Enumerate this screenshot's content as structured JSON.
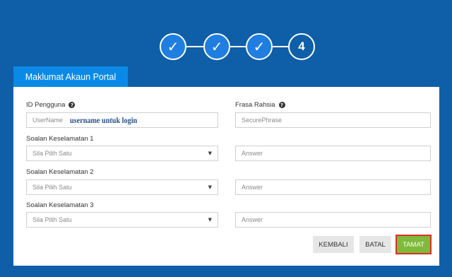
{
  "stepper": {
    "steps": [
      {
        "state": "done",
        "icon": "check-icon",
        "glyph": "✓"
      },
      {
        "state": "done",
        "icon": "check-icon",
        "glyph": "✓"
      },
      {
        "state": "done",
        "icon": "check-icon",
        "glyph": "✓"
      },
      {
        "state": "current",
        "label": "4"
      }
    ]
  },
  "tab": {
    "label": "Maklumat Akaun Portal"
  },
  "form": {
    "user_id": {
      "label": "ID Pengguna",
      "placeholder": "UserName",
      "note": "username untuk login"
    },
    "secret_phrase": {
      "label": "Frasa Rahsia",
      "placeholder": "SecurePhrase"
    },
    "questions": [
      {
        "label": "Soalan Keselamatan 1",
        "selected": "Sila Pilih Satu",
        "answer_placeholder": "Answer"
      },
      {
        "label": "Soalan Keselamatan 2",
        "selected": "Sila Pilih Satu",
        "answer_placeholder": "Answer"
      },
      {
        "label": "Soalan Keselamatan 3",
        "selected": "Sila Pilih Satu",
        "answer_placeholder": "Answer"
      }
    ]
  },
  "buttons": {
    "back": "KEMBALI",
    "cancel": "BATAL",
    "finish": "TAMAT"
  },
  "icons": {
    "help": "question-circle-icon",
    "caret": "caret-down-icon",
    "help_glyph": "?",
    "caret_glyph": "▼"
  },
  "colors": {
    "background": "#0f5ea8",
    "tab": "#0a8ae6",
    "step_done": "#1f7ee0",
    "finish_button": "#7fba3a",
    "finish_highlight": "#d9302a"
  }
}
